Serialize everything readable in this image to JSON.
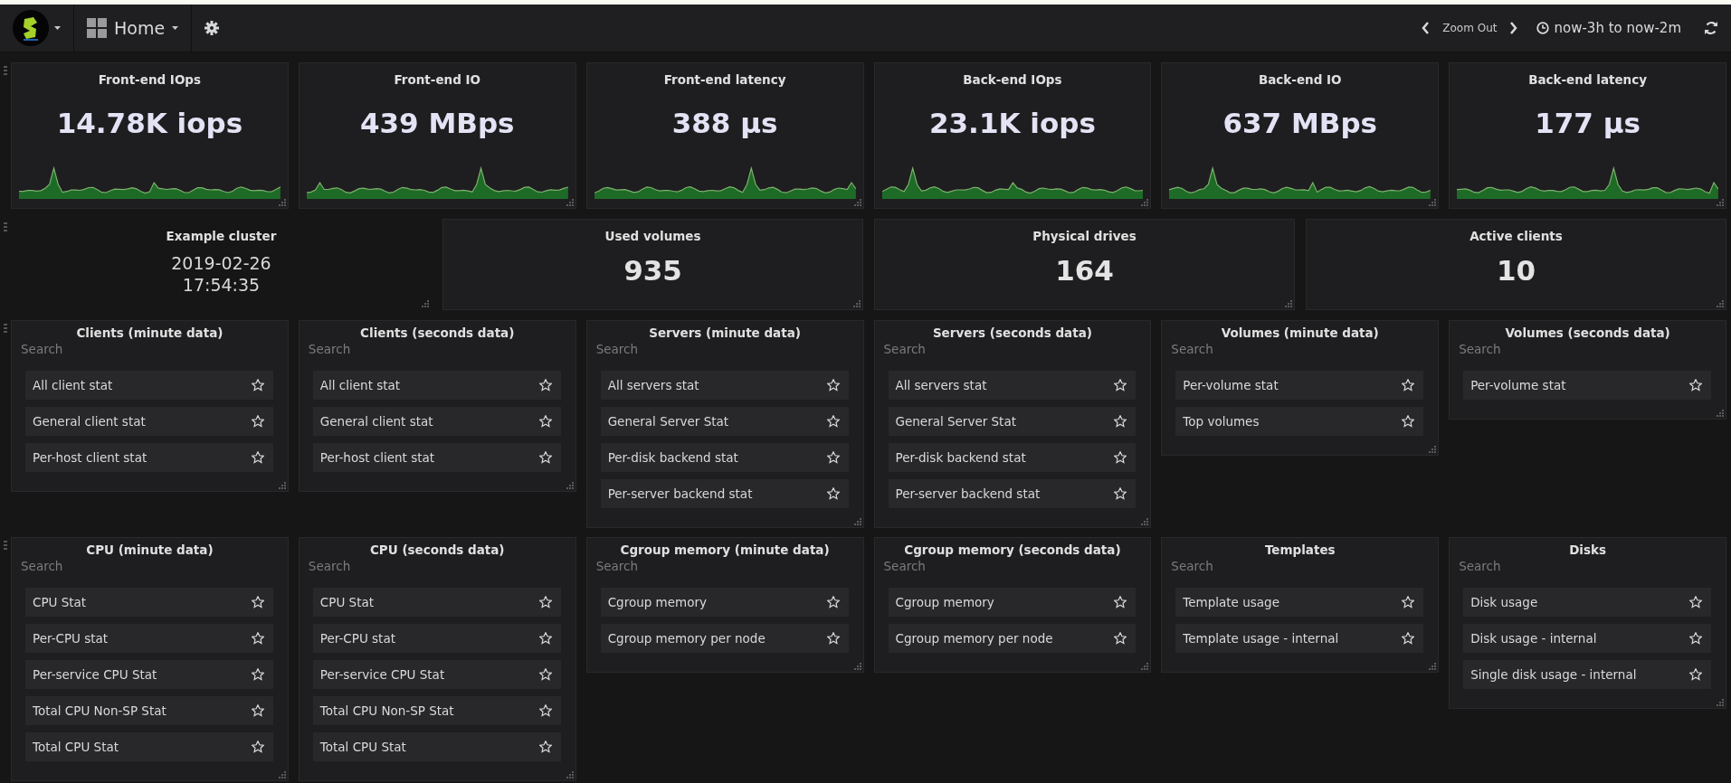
{
  "topbar": {
    "dashboard_title": "Home",
    "zoom_label": "Zoom Out",
    "time_range": "now-3h to now-2m"
  },
  "stat_panels": [
    {
      "title": "Front-end IOps",
      "value": "14.78K iops"
    },
    {
      "title": "Front-end IO",
      "value": "439 MBps"
    },
    {
      "title": "Front-end latency",
      "value": "388 µs"
    },
    {
      "title": "Back-end IOps",
      "value": "23.1K iops"
    },
    {
      "title": "Back-end IO",
      "value": "637 MBps"
    },
    {
      "title": "Back-end latency",
      "value": "177 µs"
    }
  ],
  "info_panels": [
    {
      "kind": "text",
      "title": "Example cluster",
      "lines": [
        "2019-02-26",
        "17:54:35"
      ]
    },
    {
      "kind": "stat",
      "title": "Used volumes",
      "value": "935"
    },
    {
      "kind": "stat",
      "title": "Physical drives",
      "value": "164"
    },
    {
      "kind": "stat",
      "title": "Active clients",
      "value": "10"
    }
  ],
  "list_rows": [
    [
      {
        "title": "Clients (minute data)",
        "search_placeholder": "Search",
        "items": [
          {
            "label": "All client stat",
            "starred": false
          },
          {
            "label": "General client stat",
            "starred": false
          },
          {
            "label": "Per-host client stat",
            "starred": false
          }
        ]
      },
      {
        "title": "Clients (seconds data)",
        "search_placeholder": "Search",
        "items": [
          {
            "label": "All client stat",
            "starred": false
          },
          {
            "label": "General client stat",
            "starred": false
          },
          {
            "label": "Per-host client stat",
            "starred": false
          }
        ]
      },
      {
        "title": "Servers (minute data)",
        "search_placeholder": "Search",
        "items": [
          {
            "label": "All servers stat",
            "starred": false
          },
          {
            "label": "General Server Stat",
            "starred": false
          },
          {
            "label": "Per-disk backend stat",
            "starred": false
          },
          {
            "label": "Per-server backend stat",
            "starred": false
          }
        ]
      },
      {
        "title": "Servers (seconds data)",
        "search_placeholder": "Search",
        "items": [
          {
            "label": "All servers stat",
            "starred": false
          },
          {
            "label": "General Server Stat",
            "starred": false
          },
          {
            "label": "Per-disk backend stat",
            "starred": false
          },
          {
            "label": "Per-server backend stat",
            "starred": false
          }
        ]
      },
      {
        "title": "Volumes (minute data)",
        "search_placeholder": "Search",
        "items": [
          {
            "label": "Per-volume stat",
            "starred": false
          },
          {
            "label": "Top volumes",
            "starred": false
          }
        ]
      },
      {
        "title": "Volumes (seconds data)",
        "search_placeholder": "Search",
        "items": [
          {
            "label": "Per-volume stat",
            "starred": false
          }
        ]
      }
    ],
    [
      {
        "title": "CPU (minute data)",
        "search_placeholder": "Search",
        "items": [
          {
            "label": "CPU Stat",
            "starred": false
          },
          {
            "label": "Per-CPU stat",
            "starred": false
          },
          {
            "label": "Per-service CPU Stat",
            "starred": false
          },
          {
            "label": "Total CPU Non-SP Stat",
            "starred": false
          },
          {
            "label": "Total CPU Stat",
            "starred": false
          }
        ]
      },
      {
        "title": "CPU (seconds data)",
        "search_placeholder": "Search",
        "items": [
          {
            "label": "CPU Stat",
            "starred": false
          },
          {
            "label": "Per-CPU stat",
            "starred": false
          },
          {
            "label": "Per-service CPU Stat",
            "starred": false
          },
          {
            "label": "Total CPU Non-SP Stat",
            "starred": false
          },
          {
            "label": "Total CPU Stat",
            "starred": false
          }
        ]
      },
      {
        "title": "Cgroup memory (minute data)",
        "search_placeholder": "Search",
        "items": [
          {
            "label": "Cgroup memory",
            "starred": false
          },
          {
            "label": "Cgroup memory per node",
            "starred": false
          }
        ]
      },
      {
        "title": "Cgroup memory (seconds data)",
        "search_placeholder": "Search",
        "items": [
          {
            "label": "Cgroup memory",
            "starred": false
          },
          {
            "label": "Cgroup memory per node",
            "starred": false
          }
        ]
      },
      {
        "title": "Templates",
        "search_placeholder": "Search",
        "items": [
          {
            "label": "Template usage",
            "starred": false
          },
          {
            "label": "Template usage - internal",
            "starred": false
          }
        ]
      },
      {
        "title": "Disks",
        "search_placeholder": "Search",
        "items": [
          {
            "label": "Disk usage",
            "starred": false
          },
          {
            "label": "Disk usage - internal",
            "starred": false
          },
          {
            "label": "Single disk usage - internal",
            "starred": false
          }
        ]
      }
    ]
  ]
}
